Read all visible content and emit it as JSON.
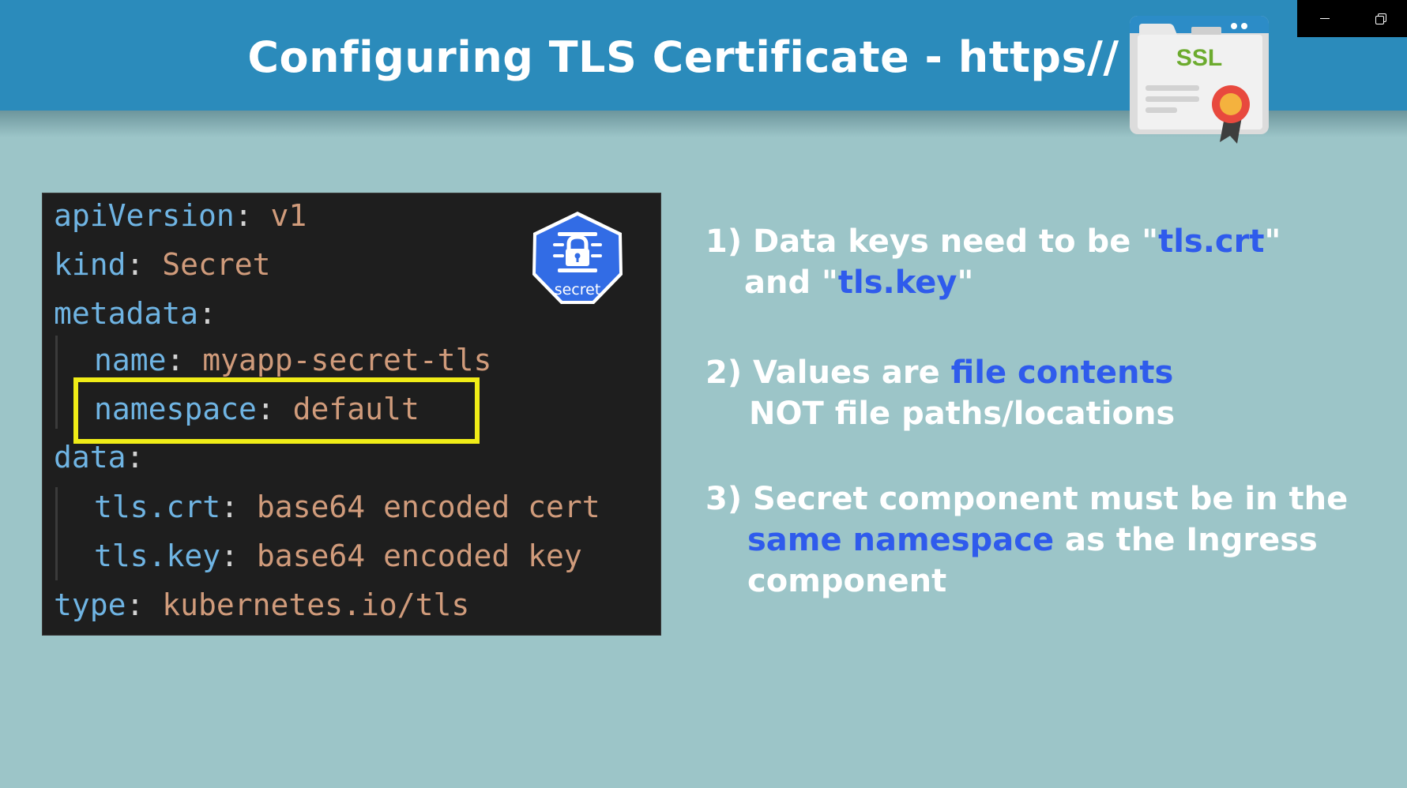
{
  "window_controls": {
    "minimize_icon": "minimize-icon",
    "restore_icon": "restore-icon"
  },
  "slide": {
    "title": "Configuring TLS Certificate - https//",
    "ssl_badge": {
      "label": "SSL",
      "icon": "ssl-certificate-icon"
    },
    "secret_icon": {
      "label": "secret",
      "icon": "lock-icon"
    },
    "code": {
      "apiVersion_key": "apiVersion",
      "apiVersion_value": "v1",
      "kind_key": "kind",
      "kind_value": "Secret",
      "metadata_key": "metadata",
      "name_key": "name",
      "name_value": "myapp-secret-tls",
      "namespace_key": "namespace",
      "namespace_value": "default",
      "data_key": "data",
      "crt_key": "tls.crt",
      "crt_value": "base64 encoded cert",
      "keyfile_key": "tls.key",
      "keyfile_value": "base64 encoded key",
      "type_key": "type",
      "type_value": "kubernetes.io/tls"
    },
    "points": [
      {
        "line1_prefix": "1) Data keys need to be \"",
        "line1_highlight": "tls.crt",
        "line1_suffix": "\"",
        "line2_prefix": "and \"",
        "line2_highlight": "tls.key",
        "line2_suffix": "\""
      },
      {
        "line1_prefix": "2) Values are ",
        "line1_highlight": "file contents",
        "line2_text": "NOT file paths/locations"
      },
      {
        "line1_text": "3) Secret component must be in the",
        "line2_highlight": "same namespace",
        "line2_suffix": " as the Ingress",
        "line3_text": "component"
      }
    ],
    "colors": {
      "header": "#2b8bbb",
      "background": "#9cc5c8",
      "highlight_text": "#2f5bec",
      "highlight_box": "#f0ec17",
      "secret_badge": "#326ce5"
    }
  }
}
